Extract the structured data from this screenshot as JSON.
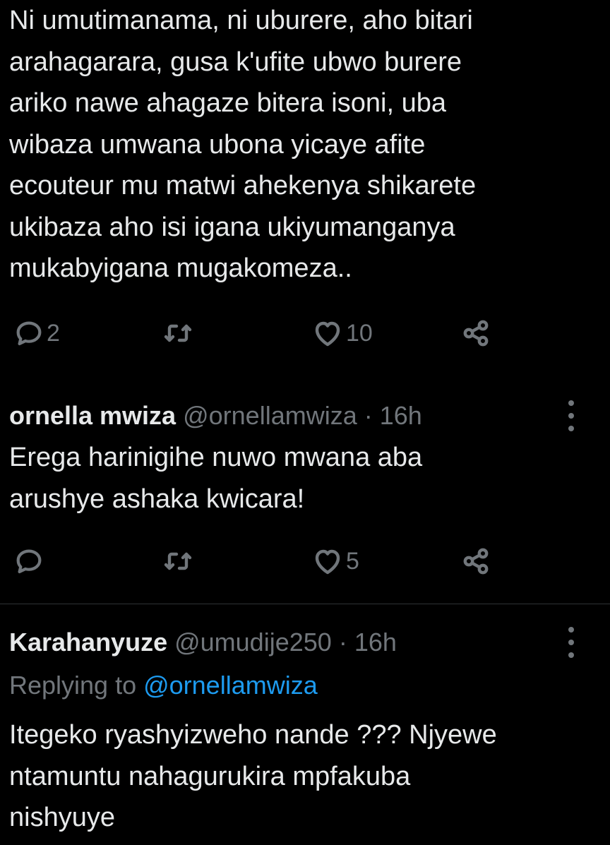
{
  "tweets": [
    {
      "text": "Ni umutimanama, ni uburere, aho bitari\narahagarara, gusa k'ufite ubwo burere\nariko nawe ahagaze bitera isoni, uba\nwibaza umwana ubona yicaye afite\necouteur mu matwi ahekenya shikarete\nukibaza aho isi igana ukiyumanganya\nmukabyigana mugakomeza..",
      "actions": {
        "reply_count": "2",
        "retweet_count": "",
        "like_count": "10"
      }
    },
    {
      "author_name": "ornella mwiza",
      "author_handle": "@ornellamwiza",
      "separator": "·",
      "time": "16h",
      "text": "Erega harinigihe nuwo mwana aba\narushye ashaka kwicara!",
      "actions": {
        "reply_count": "",
        "retweet_count": "",
        "like_count": "5"
      }
    },
    {
      "author_name": "Karahanyuze",
      "author_handle": "@umudije250",
      "separator": "·",
      "time": "16h",
      "replying_prefix": "Replying to ",
      "replying_to": "@ornellamwiza",
      "text": "Itegeko ryashyizweho nande ??? Njyewe\nntamuntu nahagurukira mpfakuba\nnishyuye"
    }
  ],
  "icons": {
    "reply": "reply-icon",
    "retweet": "retweet-icon",
    "like": "heart-icon",
    "share": "share-icon",
    "more": "more-options-icon"
  },
  "colors": {
    "background": "#000000",
    "text": "#e7e9ea",
    "secondary": "#71767b",
    "link": "#1d9bf0",
    "divider": "#2f3336"
  }
}
